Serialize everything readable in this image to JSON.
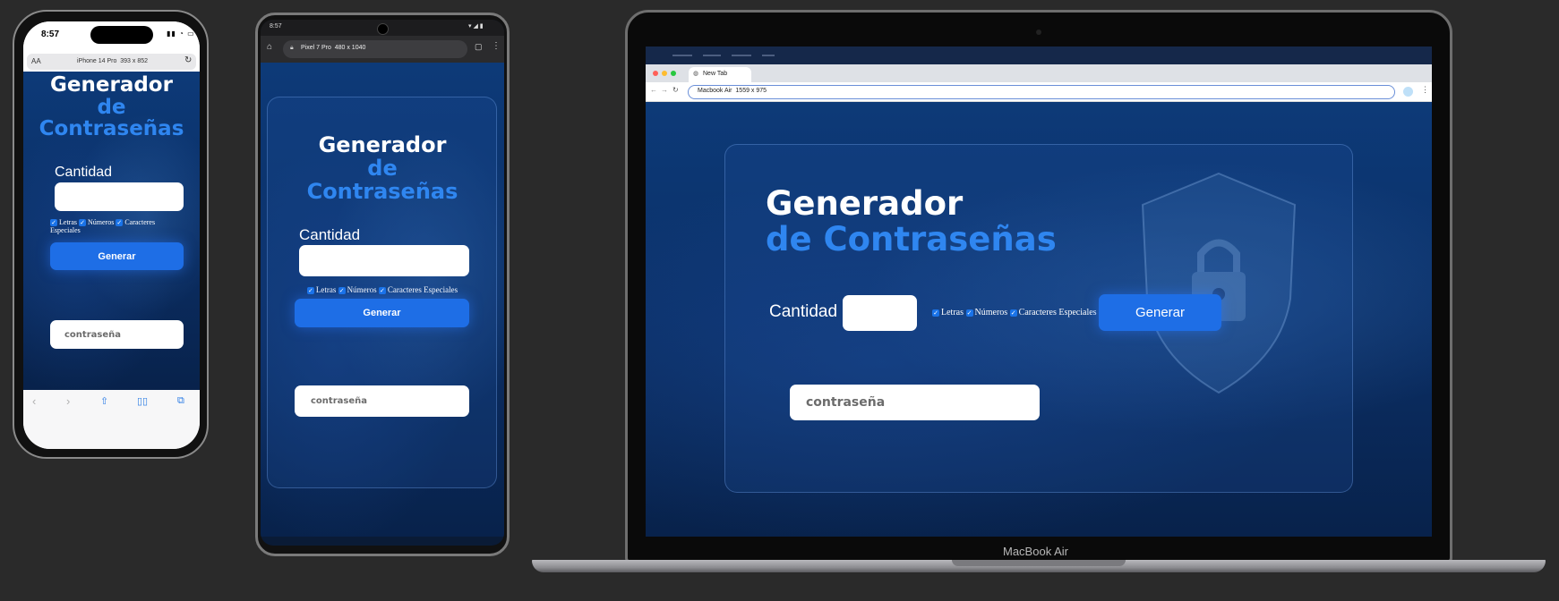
{
  "app": {
    "title_line1": "Generador",
    "title_line2_mobile_a": "de",
    "title_line2_mobile_b": "Contraseñas",
    "title_line2_desktop": "de Contraseñas",
    "quantity_label": "Cantidad",
    "checkbox_letters": "Letras",
    "checkbox_numbers": "Números",
    "checkbox_specials": "Caracteres Especiales",
    "checkbox_specials_a": "Caracteres",
    "checkbox_specials_b": "Especiales",
    "generate_button": "Generar",
    "password_placeholder": "contraseña",
    "colors": {
      "accent": "#1e6ee6",
      "title_blue": "#2f86f0",
      "bg_dark": "#0b2f66"
    }
  },
  "iphone": {
    "time": "8:57",
    "text_size_btn": "AA",
    "device_url": "iPhone 14 Pro  393 x 852",
    "icons": [
      "back-icon",
      "forward-icon",
      "share-icon",
      "bookmarks-icon",
      "tabs-icon",
      "reload-icon"
    ]
  },
  "pixel": {
    "time": "8:57",
    "device_url": "Pixel 7 Pro  480 x 1040"
  },
  "macbook": {
    "tab_label": "New Tab",
    "address": "Macbook Air  1559 x 975",
    "device_label": "MacBook Air"
  }
}
